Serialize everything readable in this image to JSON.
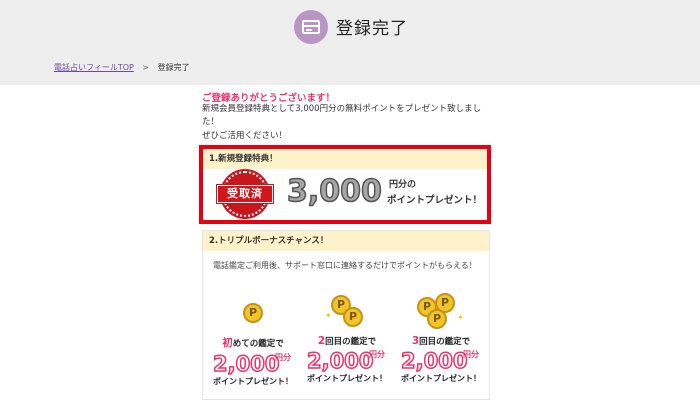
{
  "header": {
    "title": "登録完了",
    "icon": "card-icon"
  },
  "breadcrumb": {
    "home": "電話占いフィールTOP",
    "separator": ">",
    "current": "登録完了"
  },
  "message": {
    "thanks": "ご登録ありがとうございます！",
    "line1": "新規会員登録特典として3,000円分の無料ポイントをプレゼント致しました！",
    "line2": "ぜひご活用ください！"
  },
  "section1": {
    "heading": "1.新規登録特典！",
    "stamp": "受取済",
    "amount": "3,000",
    "unit": "円分の",
    "subtitle": "ポイントプレゼント！"
  },
  "section2": {
    "heading": "2.トリプルボーナスチャンス！",
    "description": "電話鑑定ご利用後、サポート窓口に連絡するだけでポイントがもらえる！",
    "bonuses": [
      {
        "label_em": "初",
        "label_rest": "めての鑑定で",
        "amount": "2,000",
        "unit": "円分",
        "subtitle": "ポイントプレゼント！"
      },
      {
        "label_em": "2",
        "label_rest": "回目の鑑定で",
        "amount": "2,000",
        "unit": "円分",
        "subtitle": "ポイントプレゼント！"
      },
      {
        "label_em": "3",
        "label_rest": "回目の鑑定で",
        "amount": "2,000",
        "unit": "円分",
        "subtitle": "ポイントプレゼント！"
      }
    ],
    "coin_mark": "P"
  },
  "colors": {
    "accent": "#e8336c",
    "highlight_border": "#e60012",
    "section_head": "#fdf2c9",
    "header_bg": "#efeeef",
    "icon_circle": "#b995c3"
  }
}
